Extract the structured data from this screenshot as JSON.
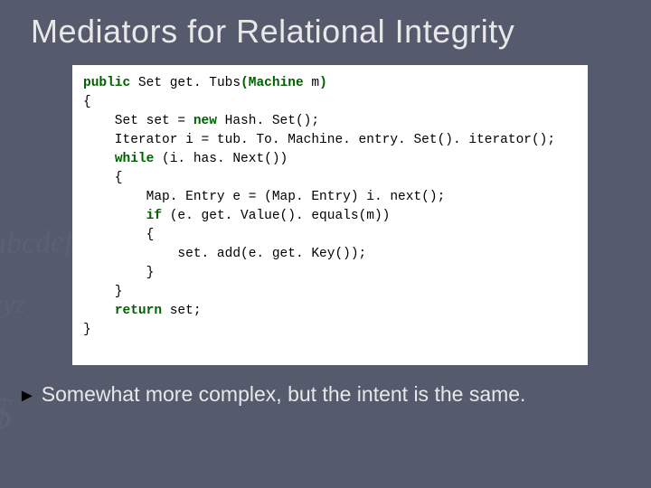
{
  "title": "Mediators for Relational Integrity",
  "code": {
    "kw_public": "public",
    "type_set": "Set",
    "fn_name": "get. Tubs",
    "param_open": "(",
    "param_type": "Machine",
    "param_name": " m",
    "param_close": ")",
    "lbrace1": "{",
    "l3a": "    Set set = ",
    "kw_new": "new",
    "l3b": " Hash. Set();",
    "l4": "    Iterator i = tub. To. Machine. entry. Set(). iterator();",
    "kw_while": "while",
    "l5b": " (i. has. Next())",
    "l6": "    {",
    "l7": "        Map. Entry e = (Map. Entry) i. next();",
    "kw_if": "if",
    "l8b": " (e. get. Value(). equals(m))",
    "l9": "        {",
    "l10": "            set. add(e. get. Key());",
    "l11": "        }",
    "l12": "    }",
    "kw_return": "return",
    "l13b": " set;",
    "rbrace": "}"
  },
  "bullet": {
    "arrow": "►",
    "text": "Somewhat more complex, but the intent is the same."
  }
}
